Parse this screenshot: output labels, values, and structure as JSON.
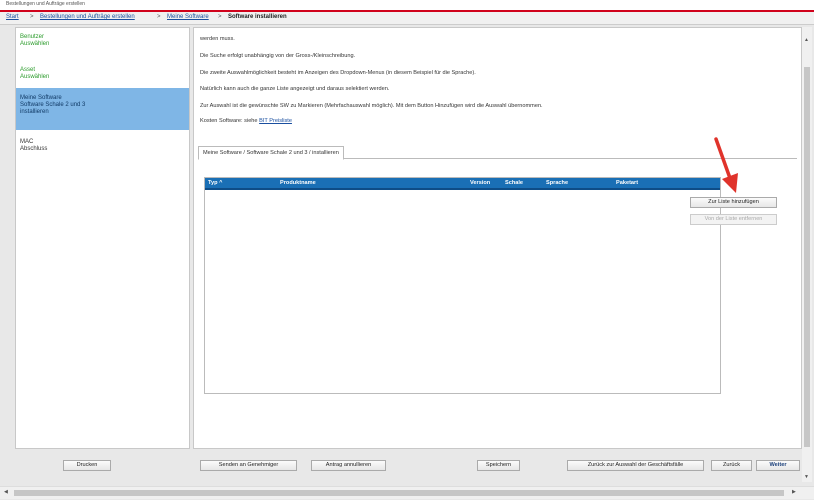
{
  "window": {
    "title": "Bestellungen und Aufträge erstellen"
  },
  "breadcrumb": {
    "items": [
      "Start",
      "Bestellungen und Aufträge erstellen",
      "Meine Software"
    ],
    "separator": ">",
    "current": "Software installieren"
  },
  "steps": [
    {
      "title": "Benutzer",
      "subtitle": "Auswählen",
      "state": "done"
    },
    {
      "title": "Asset",
      "subtitle": "Auswählen",
      "state": "done"
    },
    {
      "title": "Meine Software",
      "subtitle": "Software Schale 2 und 3",
      "subtitle2": "installieren",
      "state": "active"
    },
    {
      "title": "MAC",
      "subtitle": "Abschluss",
      "state": "todo"
    }
  ],
  "description": {
    "lines": [
      "werden muss.",
      "Die Suche erfolgt unabhängig von der Gross-/Kleinschreibung.",
      "Die zweite Auswahlmöglichkeit besteht im Anzeigen des Dropdown-Menus (in diesem Beispiel für die Sprache).",
      "Natürlich kann auch die ganze Liste angezeigt und daraus selektiert werden.",
      "Zur Auswahl ist die gewünschte SW zu Markieren (Mehrfachauswahl möglich). Mit dem Button Hinzufügen wird die Auswahl übernommen."
    ],
    "costs_text": "Kosten Software: siehe",
    "costs_link": "BIT Preisliste"
  },
  "tab": {
    "label": "Meine Software / Software Schale 2 und 3 / installieren"
  },
  "table": {
    "columns": [
      "Typ ^",
      "Produktname",
      "Version",
      "Schale",
      "Sprache",
      "Paketart"
    ],
    "rows": []
  },
  "side_buttons": {
    "add": "Zur Liste hinzufügen",
    "remove": "Von der Liste entfernen"
  },
  "footer_buttons": {
    "print": "Drucken",
    "send": "Senden an Genehmiger",
    "cancel": "Antrag annullieren",
    "save": "Speichern",
    "back_to_cases": "Zurück zur Auswahl der Geschäftsfälle",
    "back": "Zurück",
    "next": "Weiter"
  },
  "colors": {
    "accent": "#d0021b",
    "table_header": "#1a6fb5",
    "active_step": "#7fb6e6",
    "done_step": "#2b9b2b",
    "arrow": "#e0332b"
  }
}
